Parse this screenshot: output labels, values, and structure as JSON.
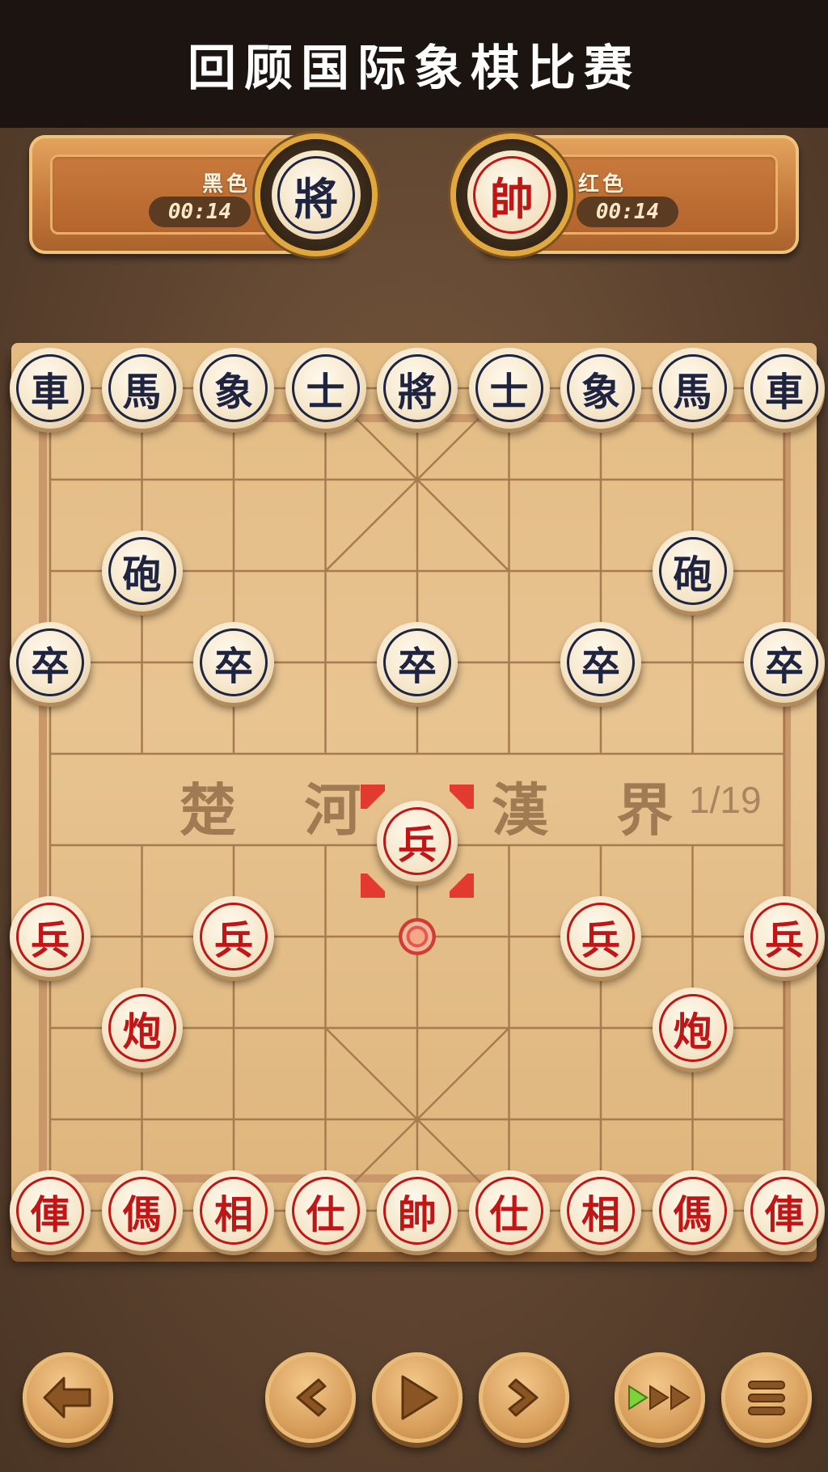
{
  "header": {
    "title": "回顾国际象棋比赛"
  },
  "players": {
    "black": {
      "name": "黑色",
      "timer": "00:14",
      "avatar_char": "將"
    },
    "red": {
      "name": "红色",
      "timer": "00:14",
      "avatar_char": "帥"
    }
  },
  "board": {
    "river_left": "楚 河",
    "river_right": "漢 界",
    "move_counter": "1/19",
    "pieces": [
      {
        "char": "車",
        "side": "black",
        "col": 0,
        "row": 0
      },
      {
        "char": "馬",
        "side": "black",
        "col": 1,
        "row": 0
      },
      {
        "char": "象",
        "side": "black",
        "col": 2,
        "row": 0
      },
      {
        "char": "士",
        "side": "black",
        "col": 3,
        "row": 0
      },
      {
        "char": "將",
        "side": "black",
        "col": 4,
        "row": 0
      },
      {
        "char": "士",
        "side": "black",
        "col": 5,
        "row": 0
      },
      {
        "char": "象",
        "side": "black",
        "col": 6,
        "row": 0
      },
      {
        "char": "馬",
        "side": "black",
        "col": 7,
        "row": 0
      },
      {
        "char": "車",
        "side": "black",
        "col": 8,
        "row": 0
      },
      {
        "char": "砲",
        "side": "black",
        "col": 1,
        "row": 2
      },
      {
        "char": "砲",
        "side": "black",
        "col": 7,
        "row": 2
      },
      {
        "char": "卒",
        "side": "black",
        "col": 0,
        "row": 3
      },
      {
        "char": "卒",
        "side": "black",
        "col": 2,
        "row": 3
      },
      {
        "char": "卒",
        "side": "black",
        "col": 4,
        "row": 3
      },
      {
        "char": "卒",
        "side": "black",
        "col": 6,
        "row": 3
      },
      {
        "char": "卒",
        "side": "black",
        "col": 8,
        "row": 3
      },
      {
        "char": "兵",
        "side": "red",
        "col": 4,
        "row": 5,
        "selected": true
      },
      {
        "char": "兵",
        "side": "red",
        "col": 0,
        "row": 6
      },
      {
        "char": "兵",
        "side": "red",
        "col": 2,
        "row": 6
      },
      {
        "char": "兵",
        "side": "red",
        "col": 6,
        "row": 6
      },
      {
        "char": "兵",
        "side": "red",
        "col": 8,
        "row": 6
      },
      {
        "char": "炮",
        "side": "red",
        "col": 1,
        "row": 7
      },
      {
        "char": "炮",
        "side": "red",
        "col": 7,
        "row": 7
      },
      {
        "char": "俥",
        "side": "red",
        "col": 0,
        "row": 9
      },
      {
        "char": "傌",
        "side": "red",
        "col": 1,
        "row": 9
      },
      {
        "char": "相",
        "side": "red",
        "col": 2,
        "row": 9
      },
      {
        "char": "仕",
        "side": "red",
        "col": 3,
        "row": 9
      },
      {
        "char": "帥",
        "side": "red",
        "col": 4,
        "row": 9
      },
      {
        "char": "仕",
        "side": "red",
        "col": 5,
        "row": 9
      },
      {
        "char": "相",
        "side": "red",
        "col": 6,
        "row": 9
      },
      {
        "char": "傌",
        "side": "red",
        "col": 7,
        "row": 9
      },
      {
        "char": "俥",
        "side": "red",
        "col": 8,
        "row": 9
      }
    ],
    "last_move_from": {
      "col": 4,
      "row": 6
    }
  },
  "controls": [
    {
      "name": "back-button",
      "icon": "back-arrow-icon"
    },
    {
      "name": "prev-move-button",
      "icon": "chevron-left-icon"
    },
    {
      "name": "play-button",
      "icon": "play-icon"
    },
    {
      "name": "next-move-button",
      "icon": "chevron-right-icon"
    },
    {
      "name": "fast-forward-button",
      "icon": "fast-forward-icon"
    },
    {
      "name": "menu-button",
      "icon": "menu-icon"
    }
  ],
  "colors": {
    "black_piece": "#1f2440",
    "red_piece": "#c01616",
    "highlight": "#e23a2e"
  }
}
